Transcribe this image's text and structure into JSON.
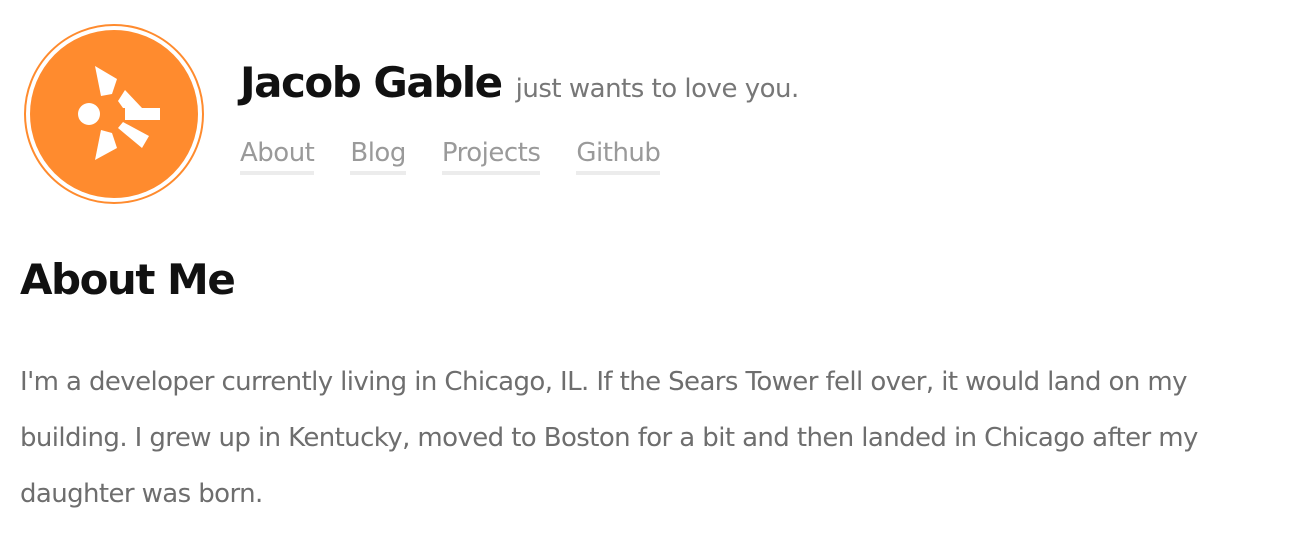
{
  "header": {
    "site_title": "Jacob Gable",
    "tagline": "just wants to love you.",
    "logo_icon": "sunburst-logo-icon",
    "brand_color": "#FF8B2E"
  },
  "nav": {
    "items": [
      {
        "label": "About"
      },
      {
        "label": "Blog"
      },
      {
        "label": "Projects"
      },
      {
        "label": "Github"
      }
    ]
  },
  "main": {
    "heading": "About Me",
    "bio": "I'm a developer currently living in Chicago, IL. If the Sears Tower fell over, it would land on my building. I grew up in Kentucky, moved to Boston for a bit and then landed in Chicago after my daughter was born."
  }
}
